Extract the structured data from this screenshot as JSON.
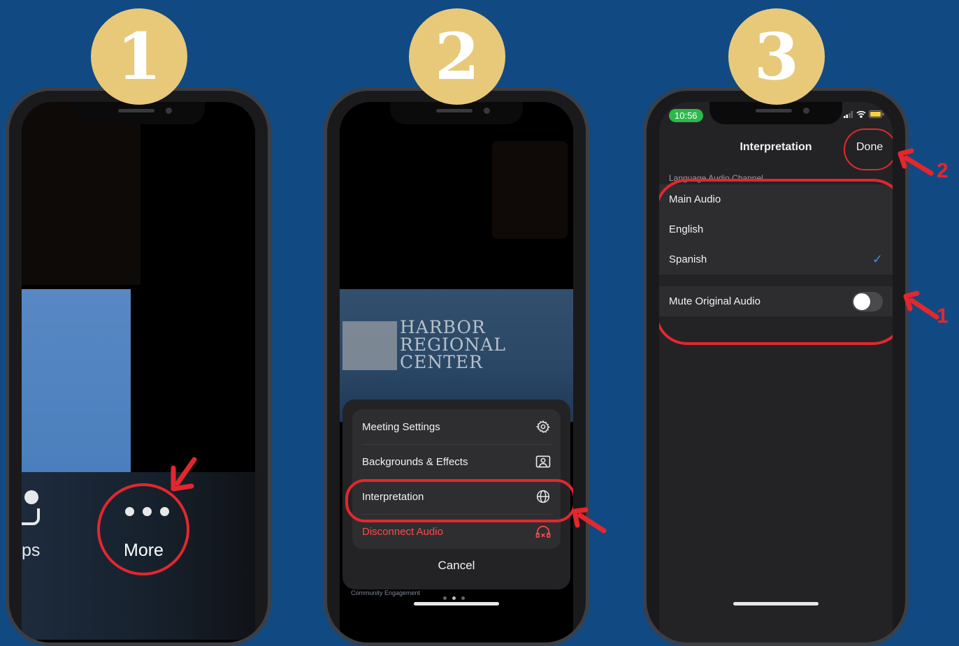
{
  "steps": {
    "one": "1",
    "two": "2",
    "three": "3"
  },
  "phone1": {
    "apps_label": "ps",
    "more_label": "More"
  },
  "phone2": {
    "logo": {
      "line1": "HARBOR",
      "line2": "REGIONAL",
      "line3": "CENTER"
    },
    "menu": [
      {
        "label": "Meeting Settings",
        "icon": "gear-icon"
      },
      {
        "label": "Backgrounds & Effects",
        "icon": "portrait-icon"
      },
      {
        "label": "Interpretation",
        "icon": "globe-icon"
      },
      {
        "label": "Disconnect Audio",
        "icon": "headphones-disconnect-icon"
      }
    ],
    "cancel_label": "Cancel",
    "footer_text": "Community Engagement"
  },
  "phone3": {
    "time": "10:56",
    "title": "Interpretation",
    "done_label": "Done",
    "section_header": "Language Audio Channel",
    "channels": [
      {
        "label": "Main Audio",
        "selected": false
      },
      {
        "label": "English",
        "selected": false
      },
      {
        "label": "Spanish",
        "selected": true
      }
    ],
    "mute_label": "Mute Original Audio",
    "mute_on": false
  },
  "callouts": {
    "first": "1",
    "second": "2"
  },
  "colors": {
    "background": "#114a82",
    "badge": "#e8c97a",
    "highlight": "#e3272e",
    "danger": "#ff4a4a",
    "accent": "#3a8cf7"
  }
}
